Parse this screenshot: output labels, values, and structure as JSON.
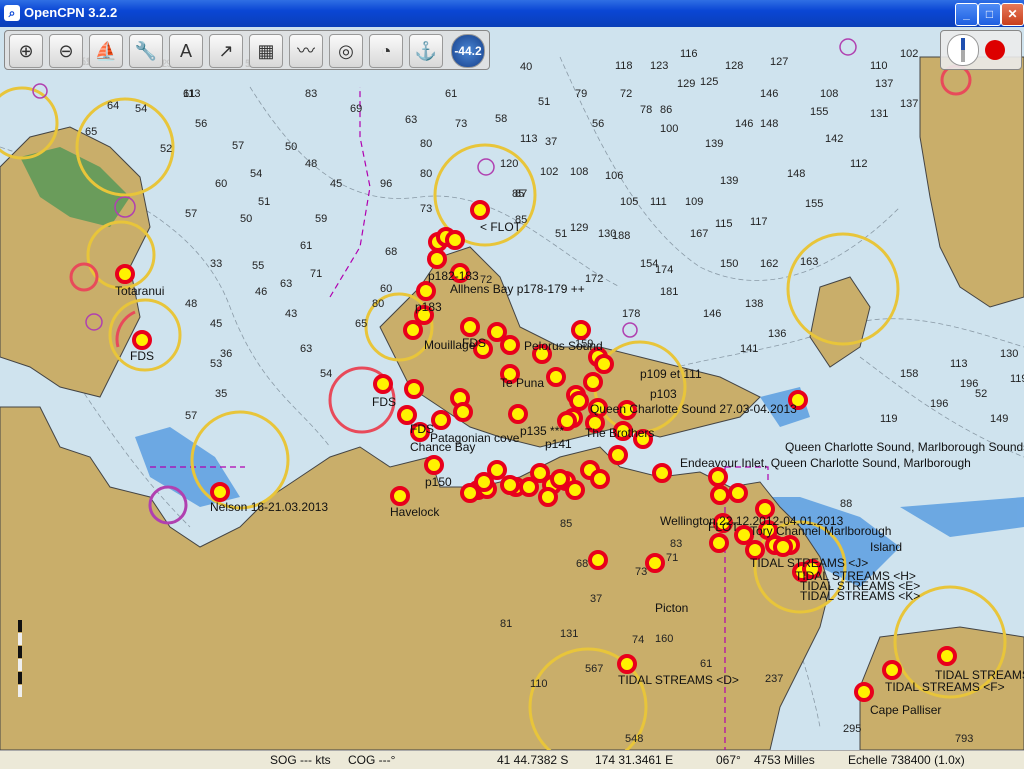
{
  "window": {
    "title": "OpenCPN 3.2.2",
    "minimize_label": "_",
    "maximize_label": "□",
    "close_label": "✕"
  },
  "toolbar": {
    "tools": [
      {
        "name": "zoom-in-icon",
        "glyph": "⊕"
      },
      {
        "name": "zoom-out-icon",
        "glyph": "⊖"
      },
      {
        "name": "ship-icon",
        "glyph": "⛵"
      },
      {
        "name": "settings-icon",
        "glyph": "🔧"
      },
      {
        "name": "text-icon",
        "glyph": "A"
      },
      {
        "name": "route-icon",
        "glyph": "↗"
      },
      {
        "name": "chart-icon",
        "glyph": "▦"
      },
      {
        "name": "track-icon",
        "glyph": "〰"
      },
      {
        "name": "mob-icon",
        "glyph": "◎"
      },
      {
        "name": "dashboard-icon",
        "glyph": "◔"
      },
      {
        "name": "tide-icon",
        "glyph": "⚓"
      }
    ],
    "rate_label": "-44.2"
  },
  "labels": [
    "Totaranui",
    "FDS",
    "Nelson 16-21.03.2013",
    "Havelock",
    "p150",
    "Picton",
    "TIDAL STREAMS <D>",
    "TIDAL STREAMS <E>",
    "TIDAL STREAMS <F>",
    "TIDAL STREAMS <L>",
    "Cape Palliser",
    "FLOT",
    "< FLOT",
    "p182-183",
    "Allhens Bay p178-179 ++",
    "p183",
    "FDS",
    "FDS",
    "FDS",
    "Mouillage",
    "Pelorus Sound",
    "Te Puna",
    "Chance Bay",
    "Patagonian cove",
    "The Brothers",
    "Queen Charlotte Sound 27.03-04.2013",
    "Endeavour Inlet, Queen Charlotte Sound, Marlborough",
    "Queen Charlotte Sound, Marlborough Sounds, Île",
    "p109 et 111",
    "p103",
    "Wellington 22.12.2012-04.01.2013",
    "Island",
    "Tory Channel Marlborough",
    "p135 ***",
    "p141",
    "TIDAL STREAMS <J>",
    "TIDAL STREAMS <H>",
    "TIDAL STREAMS <K>"
  ],
  "depths": [
    "59",
    "52",
    "61",
    "57",
    "56",
    "57",
    "64",
    "65",
    "54",
    "52",
    "54",
    "50",
    "51",
    "48",
    "45",
    "60",
    "57",
    "50",
    "59",
    "61",
    "33",
    "55",
    "63",
    "48",
    "46",
    "45",
    "43",
    "36",
    "63",
    "54",
    "35",
    "57",
    "53",
    "73",
    "85",
    "68",
    "60",
    "71",
    "80",
    "65",
    "72",
    "80",
    "80",
    "87",
    "69",
    "63",
    "61",
    "79",
    "73",
    "58",
    "51",
    "40",
    "83",
    "96",
    "85",
    "51",
    "37",
    "56",
    "72",
    "78",
    "86",
    "100",
    "102",
    "108",
    "106",
    "105",
    "111",
    "109",
    "117",
    "115",
    "129",
    "130",
    "139",
    "148",
    "155",
    "142",
    "137",
    "137",
    "131",
    "146",
    "146",
    "148",
    "155",
    "167",
    "154",
    "150",
    "162",
    "163",
    "172",
    "174",
    "181",
    "178",
    "159",
    "188",
    "146",
    "141",
    "136",
    "138",
    "139",
    "112",
    "113",
    "120",
    "127",
    "128",
    "129",
    "125",
    "123",
    "118",
    "116",
    "110",
    "108",
    "102",
    "68",
    "74",
    "71",
    "73",
    "88",
    "83",
    "85",
    "81",
    "61",
    "160",
    "237",
    "295",
    "793",
    "567",
    "548",
    "37",
    "131",
    "110",
    "119",
    "113",
    "52",
    "130",
    "158",
    "196",
    "196",
    "149",
    "119",
    "118",
    "119",
    "113",
    "112"
  ],
  "status": {
    "sog": "SOG --- kts",
    "cog": "COG ---°",
    "lat": "41 44.7382 S",
    "lon": "174 31.3461 E",
    "bearing": "067°",
    "distance": "4753 Milles",
    "scale": "Echelle 738400 (1.0x)"
  },
  "colors": {
    "sea": "#cfe3ee",
    "shallow": "#5b9ee0",
    "land": "#c9ae6a",
    "marker_ring": "#e8001c",
    "marker_fill": "#fff200",
    "sector": "#e8c53a"
  }
}
